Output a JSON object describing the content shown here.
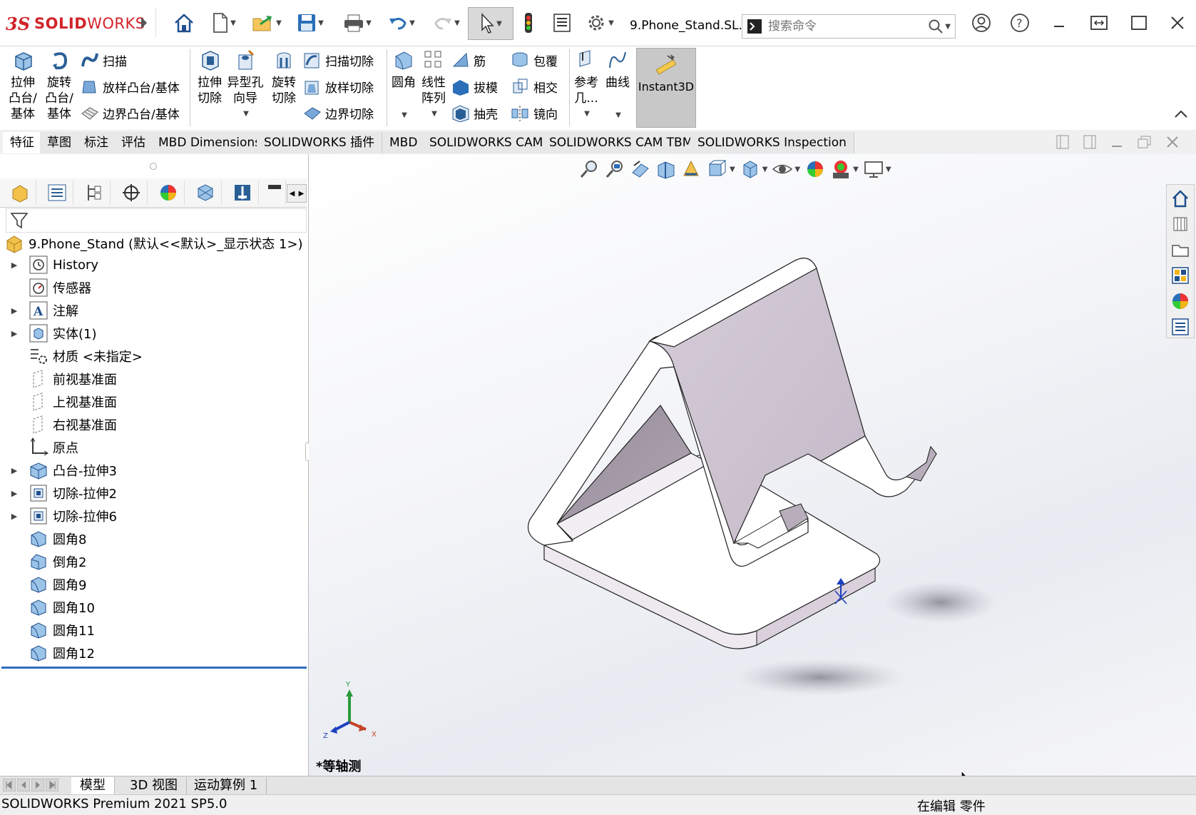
{
  "app": {
    "brand_ds": "3S",
    "brand_bold": "SOLID",
    "brand_light": "WORKS",
    "document_title": "9.Phone_Stand.SL...",
    "search_placeholder": "搜索命令"
  },
  "ribbon": {
    "extrude_boss": "拉伸\n凸台/\n基体",
    "revolve_boss": "旋转\n凸台/\n基体",
    "sweep": "扫描",
    "loft_boss": "放样凸台/基体",
    "boundary_boss": "边界凸台/基体",
    "extrude_cut": "拉伸\n切除",
    "hole_wizard": "异型孔\n向导",
    "revolve_cut": "旋转\n切除",
    "swept_cut": "扫描切除",
    "lofted_cut": "放样切除",
    "boundary_cut": "边界切除",
    "fillet": "圆角",
    "linear_pattern": "线性\n阵列",
    "rib": "筋",
    "draft": "拔模",
    "shell": "抽壳",
    "wrap": "包覆",
    "intersect": "相交",
    "mirror": "镜向",
    "reference_geometry": "参考\n几...",
    "curves": "曲线",
    "instant3d": "Instant3D"
  },
  "command_tabs": [
    "特征",
    "草图",
    "标注",
    "评估",
    "MBD Dimensions",
    "SOLIDWORKS 插件",
    "MBD",
    "SOLIDWORKS CAM",
    "SOLIDWORKS CAM TBM",
    "SOLIDWORKS Inspection"
  ],
  "tree": {
    "root": "9.Phone_Stand  (默认<<默认>_显示状态 1>)",
    "items": [
      {
        "label": "History",
        "expandable": true,
        "icon": "history-icon"
      },
      {
        "label": "传感器",
        "expandable": false,
        "icon": "sensor-icon"
      },
      {
        "label": "注解",
        "expandable": true,
        "icon": "annotation-icon"
      },
      {
        "label": "实体(1)",
        "expandable": true,
        "icon": "solid-body-icon"
      },
      {
        "label": "材质 <未指定>",
        "expandable": false,
        "icon": "material-icon"
      },
      {
        "label": "前视基准面",
        "expandable": false,
        "icon": "plane-icon"
      },
      {
        "label": "上视基准面",
        "expandable": false,
        "icon": "plane-icon"
      },
      {
        "label": "右视基准面",
        "expandable": false,
        "icon": "plane-icon"
      },
      {
        "label": "原点",
        "expandable": false,
        "icon": "origin-icon"
      },
      {
        "label": "凸台-拉伸3",
        "expandable": true,
        "icon": "boss-extrude-icon"
      },
      {
        "label": "切除-拉伸2",
        "expandable": true,
        "icon": "cut-extrude-icon"
      },
      {
        "label": "切除-拉伸6",
        "expandable": true,
        "icon": "cut-extrude-icon"
      },
      {
        "label": "圆角8",
        "expandable": false,
        "icon": "fillet-icon"
      },
      {
        "label": "倒角2",
        "expandable": false,
        "icon": "chamfer-icon"
      },
      {
        "label": "圆角9",
        "expandable": false,
        "icon": "fillet-icon"
      },
      {
        "label": "圆角10",
        "expandable": false,
        "icon": "fillet-icon"
      },
      {
        "label": "圆角11",
        "expandable": false,
        "icon": "fillet-icon"
      },
      {
        "label": "圆角12",
        "expandable": false,
        "icon": "fillet-icon"
      }
    ]
  },
  "viewport": {
    "view_name": "*等轴测",
    "triad": {
      "x": "X",
      "y": "Y",
      "z": "Z"
    }
  },
  "bottom_tabs": [
    "模型",
    "3D 视图",
    "运动算例 1"
  ],
  "status": {
    "left": "SOLIDWORKS Premium 2021 SP5.0",
    "right": "在编辑 零件"
  },
  "colors": {
    "brand_red": "#d1232a",
    "part_face": "#c9bfcc",
    "part_face_dark": "#8f8793",
    "selection_blue": "#2f6ebf"
  }
}
